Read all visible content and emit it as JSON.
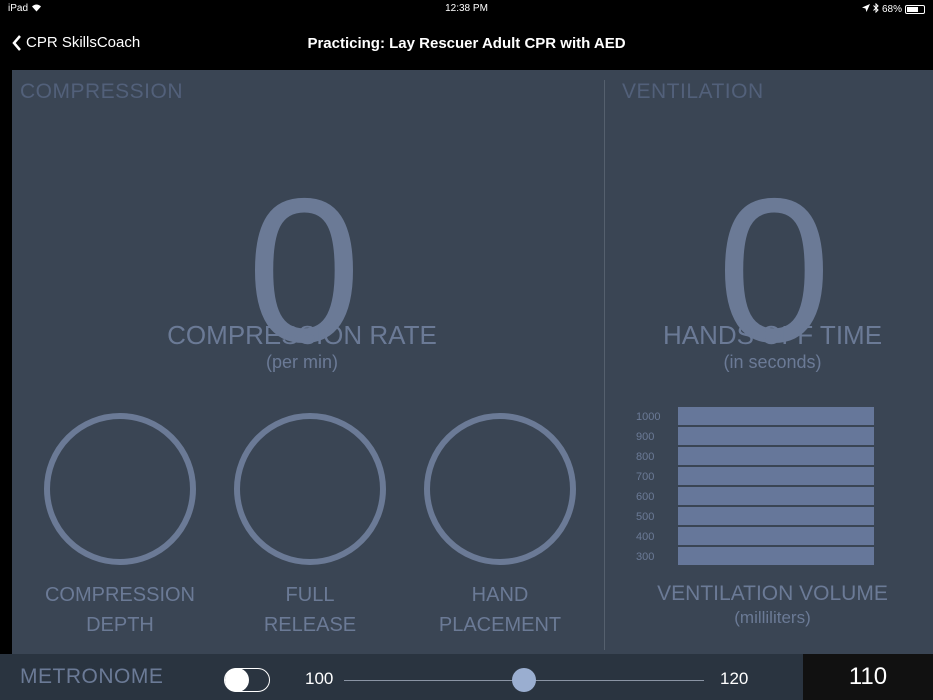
{
  "status_bar": {
    "device": "iPad",
    "time": "12:38 PM",
    "battery_percent": "68%",
    "battery_level": 0.68,
    "icons": [
      "wifi-icon",
      "location-icon",
      "bluetooth-icon",
      "battery-icon"
    ]
  },
  "nav": {
    "back_label": "CPR SkillsCoach",
    "title": "Practicing: Lay Rescuer Adult CPR with AED"
  },
  "compression": {
    "section_title": "COMPRESSION",
    "rate_value": "0",
    "rate_label": "COMPRESSION RATE",
    "rate_unit": "(per min)",
    "indicators": [
      {
        "line1": "COMPRESSION",
        "line2": "DEPTH"
      },
      {
        "line1": "FULL",
        "line2": "RELEASE"
      },
      {
        "line1": "HAND",
        "line2": "PLACEMENT"
      }
    ]
  },
  "ventilation": {
    "section_title": "VENTILATION",
    "hands_off_value": "0",
    "hands_off_label": "HANDS OFF TIME",
    "hands_off_unit": "(in seconds)",
    "volume_scale": [
      "1000",
      "900",
      "800",
      "700",
      "600",
      "500",
      "400",
      "300"
    ],
    "volume_label": "VENTILATION VOLUME",
    "volume_unit": "(milliliters)"
  },
  "metronome": {
    "label": "METRONOME",
    "enabled": false,
    "slider_min": "100",
    "slider_max": "120",
    "slider_value": 110,
    "display_value": "110"
  },
  "colors": {
    "panel": "#3a4554",
    "muted_text": "#6b7a96",
    "bar_fill": "#66779a",
    "bottom_bar": "#2a3440"
  }
}
